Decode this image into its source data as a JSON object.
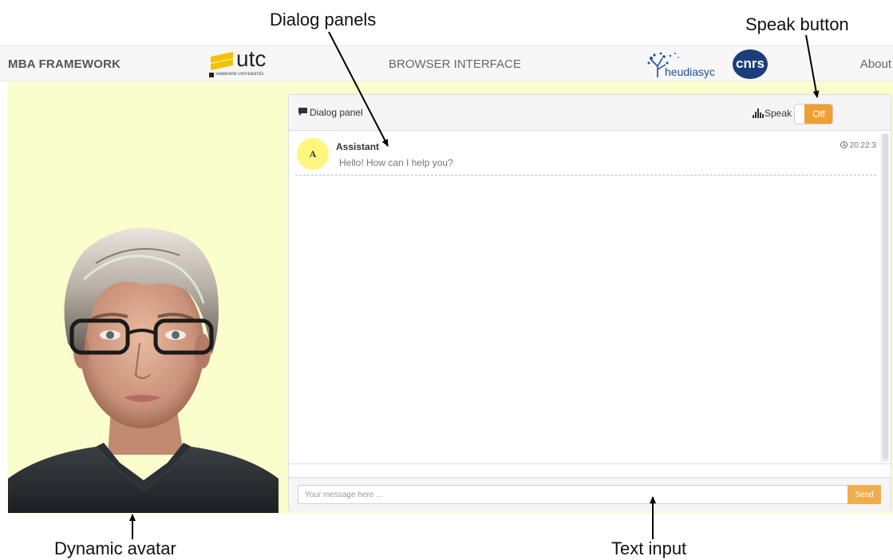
{
  "annotations": {
    "dialog_panels": "Dialog panels",
    "speak_button": "Speak button",
    "dynamic_avatar": "Dynamic avatar",
    "text_input": "Text input"
  },
  "navbar": {
    "brand": "MBA FRAMEWORK",
    "center_title": "BROWSER INTERFACE",
    "about_link": "About",
    "logos": {
      "utc": "utc",
      "utc_sub": "SORBONNE UNIVERSITÉS",
      "heudiasyc": "heudiasyc",
      "cnrs": "cnrs"
    }
  },
  "panel": {
    "title": "Dialog panel",
    "title_icon": "comment-icon",
    "speak_label": "Speak",
    "speak_icon": "equalizer-icon",
    "speak_toggle": "Off"
  },
  "messages": [
    {
      "avatar_letter": "A",
      "sender": "Assistant",
      "text": "Hello! How can I help you?",
      "time": "20:22:3"
    }
  ],
  "input": {
    "placeholder": "Your message here ...",
    "send_label": "Send"
  },
  "colors": {
    "page_background": "#fafdcc",
    "accent": "#f0ad4e",
    "avatar_bubble": "#fef67e",
    "navbar": "#f7f7f7"
  }
}
